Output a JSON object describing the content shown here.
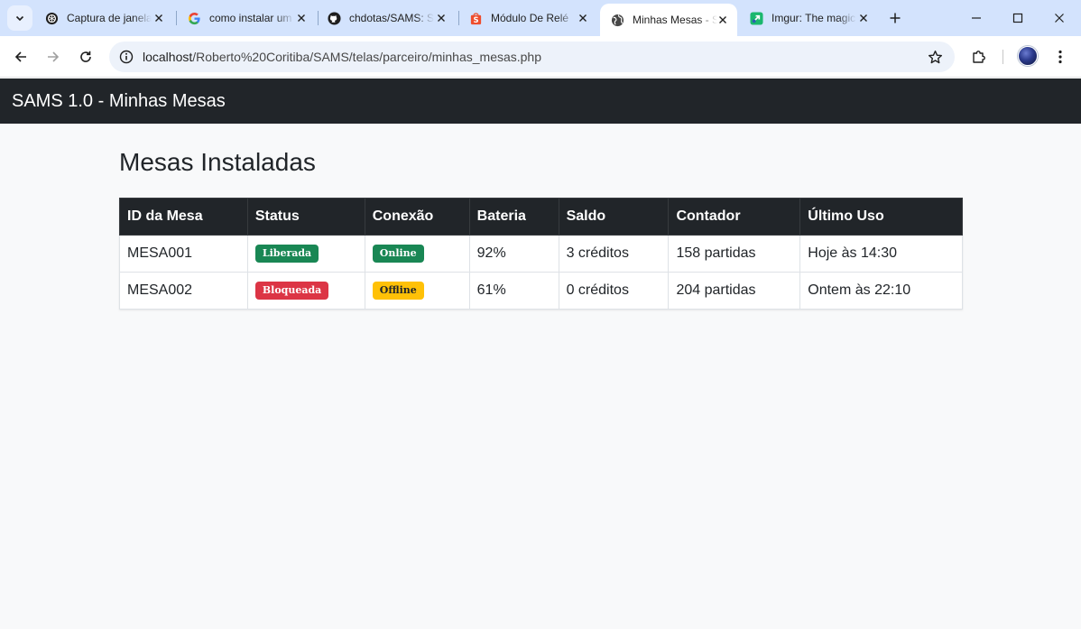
{
  "browser": {
    "tabs": [
      {
        "title": "Captura de janela",
        "icon": "openai-icon",
        "active": false
      },
      {
        "title": "como instalar um",
        "icon": "google-icon",
        "active": false
      },
      {
        "title": "chdotas/SAMS: S",
        "icon": "github-icon",
        "active": false
      },
      {
        "title": "Módulo De Relé",
        "icon": "shopee-icon",
        "active": false
      },
      {
        "title": "Minhas Mesas - S",
        "icon": "globe-icon",
        "active": true
      },
      {
        "title": "Imgur: The magic",
        "icon": "imgur-icon",
        "active": false
      }
    ],
    "url_host": "localhost",
    "url_path": "/Roberto%20Coritiba/SAMS/telas/parceiro/minhas_mesas.php"
  },
  "navbar": {
    "brand": "SAMS 1.0 - Minhas Mesas"
  },
  "page": {
    "title": "Mesas Instaladas"
  },
  "table": {
    "headers": [
      "ID da Mesa",
      "Status",
      "Conexão",
      "Bateria",
      "Saldo",
      "Contador",
      "Último Uso"
    ],
    "rows": [
      {
        "id": "MESA001",
        "status": "Liberada",
        "status_color": "#198754",
        "conexao": "Online",
        "conexao_color": "#198754",
        "bateria": "92%",
        "saldo": "3 créditos",
        "contador": "158 partidas",
        "ultimo_uso": "Hoje às 14:30"
      },
      {
        "id": "MESA002",
        "status": "Bloqueada",
        "status_color": "#dc3545",
        "conexao": "Offline",
        "conexao_color": "#ffc107",
        "bateria": "61%",
        "saldo": "0 créditos",
        "contador": "204 partidas",
        "ultimo_uso": "Ontem às 22:10"
      }
    ]
  }
}
